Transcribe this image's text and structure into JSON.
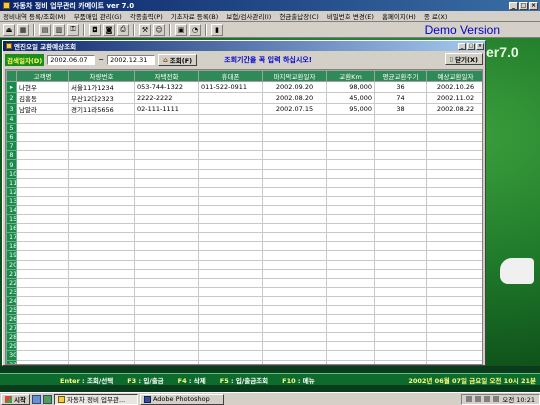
{
  "window": {
    "title": "자동차 정비 업무관리 카메이트 ver 7.0",
    "demo_label": "Demo Version",
    "version_art": "er7.0"
  },
  "menu": [
    "정비내역 등록/조회(M)",
    "부품매입 관리(G)",
    "각종출력(P)",
    "기초자료 등록(B)",
    "보험/검사관리(I)",
    "현금출납장(C)",
    "비밀번호 변경(E)",
    "홈페이지(H)",
    "종 료(X)"
  ],
  "child": {
    "title": "엔진오일 교환예상조회",
    "query_label": "검색일자(D)",
    "date_from": "2002.06.07",
    "tilde": "~",
    "date_to": "2002.12.31",
    "search_button": "조회(F)",
    "notice": "조회기간을 꼭 입력 하십시오!",
    "close_button": "닫기(X)"
  },
  "grid": {
    "columns": [
      "고객명",
      "차량번호",
      "자택전화",
      "휴대폰",
      "마지막교환일자",
      "교환Km",
      "평균교환주기",
      "예상교환일자"
    ],
    "rows": [
      [
        "나현우",
        "서울11가1234",
        "053-744-1322",
        "011-522-0911",
        "2002.09.20",
        "98,000",
        "36",
        "2002.10.26"
      ],
      [
        "김홍동",
        "부산12다2323",
        "2222-2222",
        "",
        "2002.08.20",
        "45,000",
        "74",
        "2002.11.02"
      ],
      [
        "남말라",
        "경기11라5656",
        "02-111-1111",
        "",
        "2002.07.15",
        "95,000",
        "38",
        "2002.08.22"
      ]
    ],
    "empty_rows": 28
  },
  "statusbar": {
    "keys": [
      {
        "key": "Enter",
        "label": "조회/선택"
      },
      {
        "key": "F3",
        "label": "입/출금"
      },
      {
        "key": "F4",
        "label": "삭제"
      },
      {
        "key": "F5",
        "label": "입/출금조회"
      },
      {
        "key": "F10",
        "label": "메뉴"
      }
    ],
    "datetime": "2002년 06월 07일  금요일   오전 10시 21분"
  },
  "taskbar": {
    "start": "시작",
    "tasks": [
      "자동차 정비 업무관...",
      "Adobe Photoshop"
    ],
    "clock": "오전 10:21"
  }
}
